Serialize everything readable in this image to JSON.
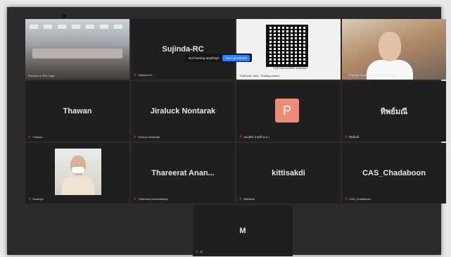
{
  "toast": {
    "message": "Not hearing anything?",
    "button": "Turn up volume"
  },
  "tiles": {
    "r0c0": {
      "name": "",
      "label": "Fareeha & Pilot Yoga"
    },
    "r0c1": {
      "name": "Sujinda-RC",
      "label": "Sujinda-RC"
    },
    "r0c2": {
      "name": "",
      "label": "ThaiCode Labs · Sharing screen",
      "caption": "กรุณาสแกนรหัสผ่านของคุณ"
    },
    "r0c3": {
      "name": "",
      "label": "Porntep Sonkhunarak (Peem) Thanee"
    },
    "r1c0": {
      "name": "Thawan",
      "label": "Thawan"
    },
    "r1c1": {
      "name": "Jiraluck Nontarak",
      "label": "Jiraluck Nontarak"
    },
    "r1c2": {
      "name": "",
      "label": "นพ.สุทิน หมดดี (ผ.อ.)",
      "avatar_letter": "P"
    },
    "r1c3": {
      "name": "ทิพย์มณี",
      "label": "ทิพย์มณี"
    },
    "r2c0": {
      "name": "",
      "label": "Sukanya"
    },
    "r2c1": {
      "name": "Thareerat  Anan...",
      "label": "Thareerat Ananchaisarp"
    },
    "r2c2": {
      "name": "kittisakdi",
      "label": "kittisakdi"
    },
    "r2c3": {
      "name": "CAS_Chadaboon",
      "label": "CAS_Chadaboon"
    },
    "r3c2": {
      "name": "M",
      "label": "M"
    }
  },
  "colors": {
    "active_speaker": "#35c46a",
    "mic_muted": "#e13a3a",
    "button": "#2d7ff9",
    "avatar": "#ef8c78"
  },
  "icons": {
    "mic": "mic-muted-icon"
  }
}
